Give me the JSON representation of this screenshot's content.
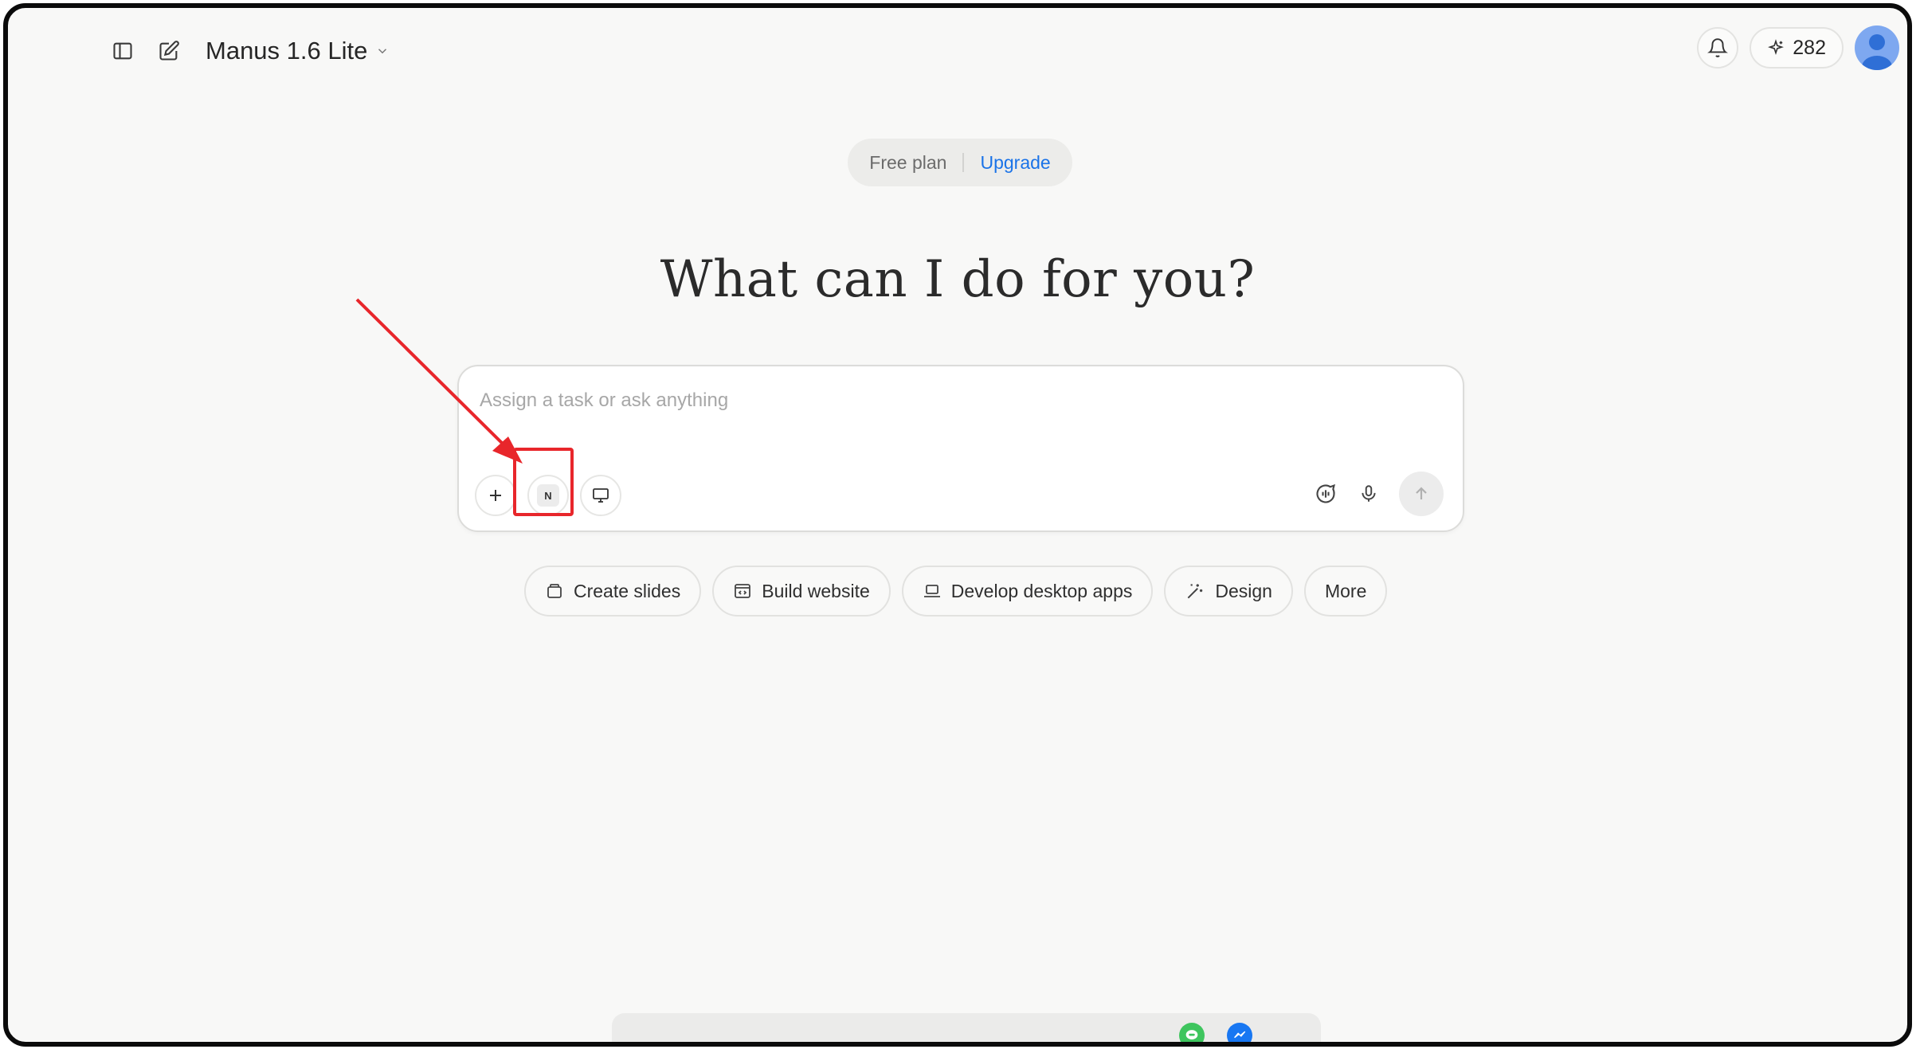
{
  "header": {
    "model_label": "Manus 1.6 Lite",
    "credits": "282"
  },
  "plan": {
    "free_label": "Free plan",
    "upgrade_label": "Upgrade"
  },
  "headline": "What can I do for you?",
  "composer": {
    "placeholder": "Assign a task or ask anything",
    "notion_letter": "N"
  },
  "chips": [
    {
      "label": "Create slides"
    },
    {
      "label": "Build website"
    },
    {
      "label": "Develop desktop apps"
    },
    {
      "label": "Design"
    },
    {
      "label": "More"
    }
  ],
  "annotation": {
    "arrow_color": "#e8262b",
    "box_color": "#e8262b"
  },
  "colors": {
    "accent": "#1a73e8",
    "background": "#f8f8f7"
  }
}
